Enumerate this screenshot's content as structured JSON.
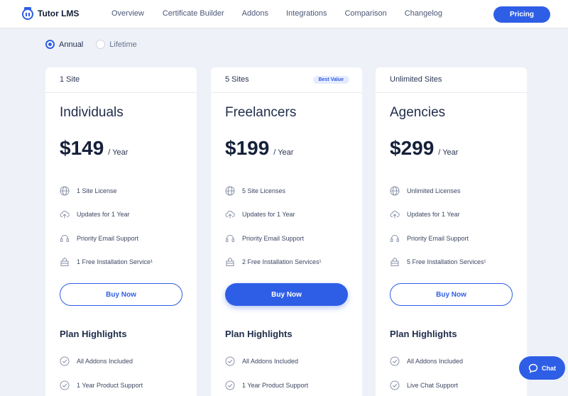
{
  "header": {
    "logo_text": "Tutor LMS",
    "nav": [
      "Overview",
      "Certificate Builder",
      "Addons",
      "Integrations",
      "Comparison",
      "Changelog"
    ],
    "cta_label": "Pricing"
  },
  "billing": {
    "options": [
      "Annual",
      "Lifetime"
    ],
    "selected": "Annual"
  },
  "plans": [
    {
      "sites": "1 Site",
      "badge": "",
      "name": "Individuals",
      "price": "$149",
      "period": "/ Year",
      "features": [
        "1 Site License",
        "Updates for 1 Year",
        "Priority Email Support",
        "1 Free Installation Service¹"
      ],
      "button": "Buy Now",
      "highlights_title": "Plan Highlights",
      "highlights": [
        "All Addons Included",
        "1 Year Product Support"
      ]
    },
    {
      "sites": "5 Sites",
      "badge": "Best Value",
      "name": "Freelancers",
      "price": "$199",
      "period": "/ Year",
      "features": [
        "5 Site Licenses",
        "Updates for 1 Year",
        "Priority Email Support",
        "2 Free Installation Services¹"
      ],
      "button": "Buy Now",
      "highlights_title": "Plan Highlights",
      "highlights": [
        "All Addons Included",
        "1 Year Product Support"
      ]
    },
    {
      "sites": "Unlimited Sites",
      "badge": "",
      "name": "Agencies",
      "price": "$299",
      "period": "/ Year",
      "features": [
        "Unlimited Licenses",
        "Updates for 1 Year",
        "Priority Email Support",
        "5 Free Installation Services¹"
      ],
      "button": "Buy Now",
      "highlights_title": "Plan Highlights",
      "highlights": [
        "All Addons Included",
        "Live Chat Support"
      ]
    }
  ],
  "feature_icons": [
    "globe-icon",
    "cloud-upload-icon",
    "headset-icon",
    "installation-box-icon"
  ],
  "chat": {
    "label": "Chat"
  },
  "colors": {
    "accent": "#2f5ee6",
    "background": "#eef1f7",
    "text": "#1f2d4b"
  }
}
